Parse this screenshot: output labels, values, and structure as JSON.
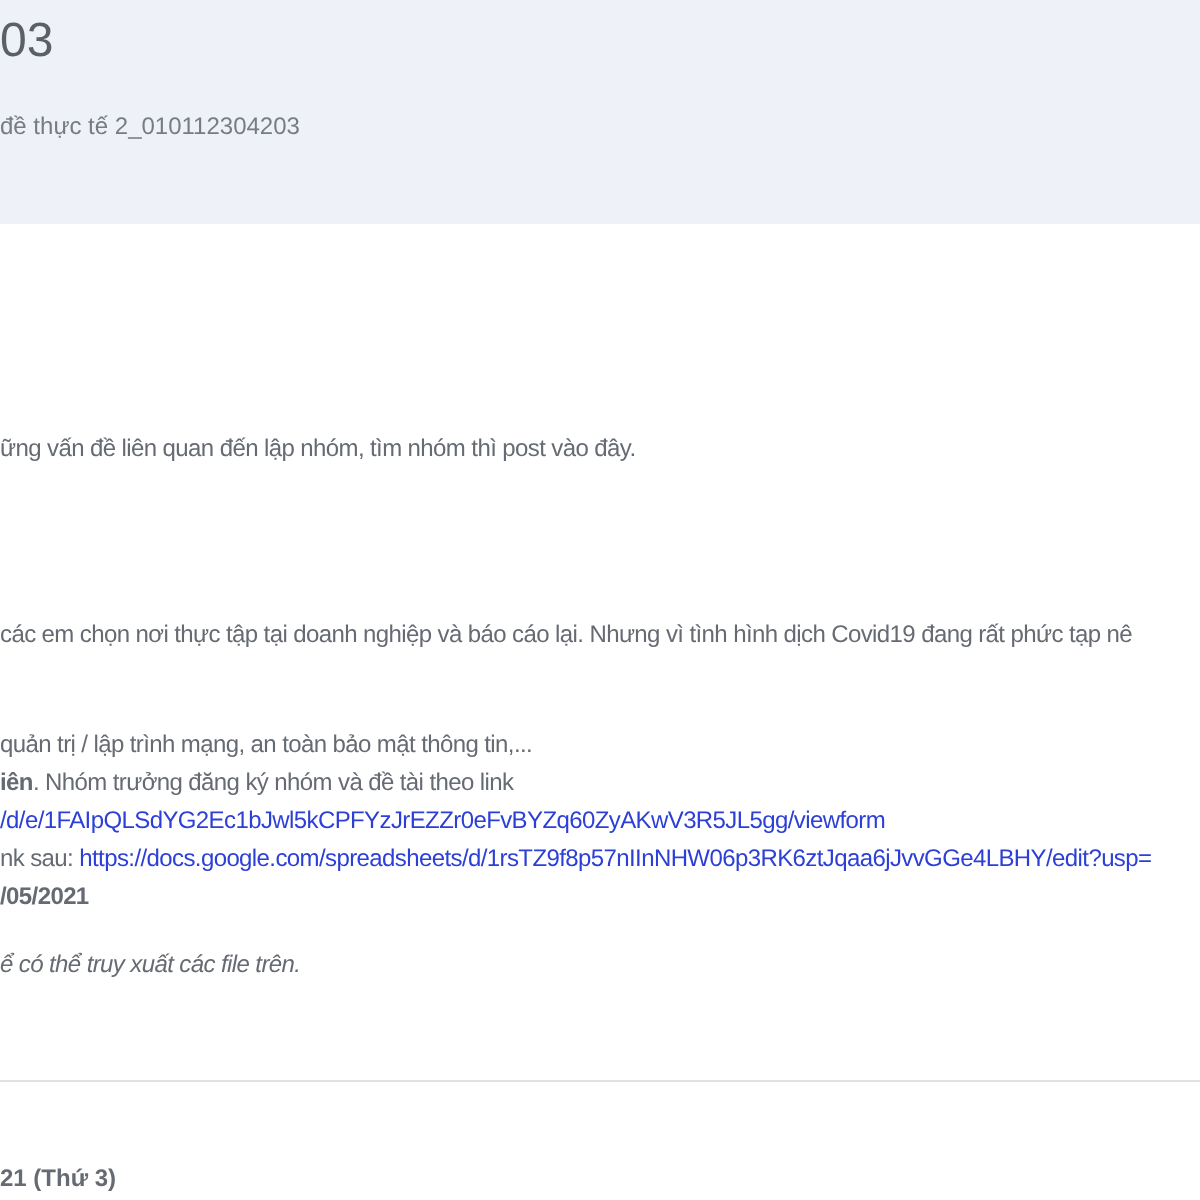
{
  "header": {
    "title": "03",
    "subtitle": "đề thực tế 2_010112304203"
  },
  "blocks": [
    [
      {
        "kind": "text",
        "text": "ững vấn đề liên quan đến lập nhóm, tìm nhóm thì post vào đây."
      }
    ],
    [
      {
        "kind": "text",
        "text": "các em chọn nơi thực tập tại doanh nghiệp và báo cáo lại. Nhưng vì tình hình dịch Covid19 đang rất phức tạp nê"
      }
    ],
    [
      {
        "kind": "text",
        "text": "quản trị / lập trình mạng, an toàn bảo mật thông tin,..."
      },
      {
        "kind": "text",
        "text": "**iên**. Nhóm trưởng đăng ký nhóm và đề tài theo link"
      },
      {
        "kind": "link",
        "text": "/d/e/1FAIpQLSdYG2Ec1bJwl5kCPFYzJrEZZr0eFvBYZq60ZyAKwV3R5JL5gg/viewform"
      },
      {
        "kind": "text_link",
        "text": "nk sau:",
        "link": "https://docs.google.com/spreadsheets/d/1rsTZ9f8p57nIInNHW06p3RK6ztJqaa6jJvvGGe4LBHY/edit?usp="
      },
      {
        "kind": "bold",
        "text": "/05/2021"
      }
    ],
    [
      {
        "kind": "italic",
        "text": "ể có thể truy xuất các file trên."
      }
    ]
  ],
  "next_heading": "21 (Thứ 3)"
}
